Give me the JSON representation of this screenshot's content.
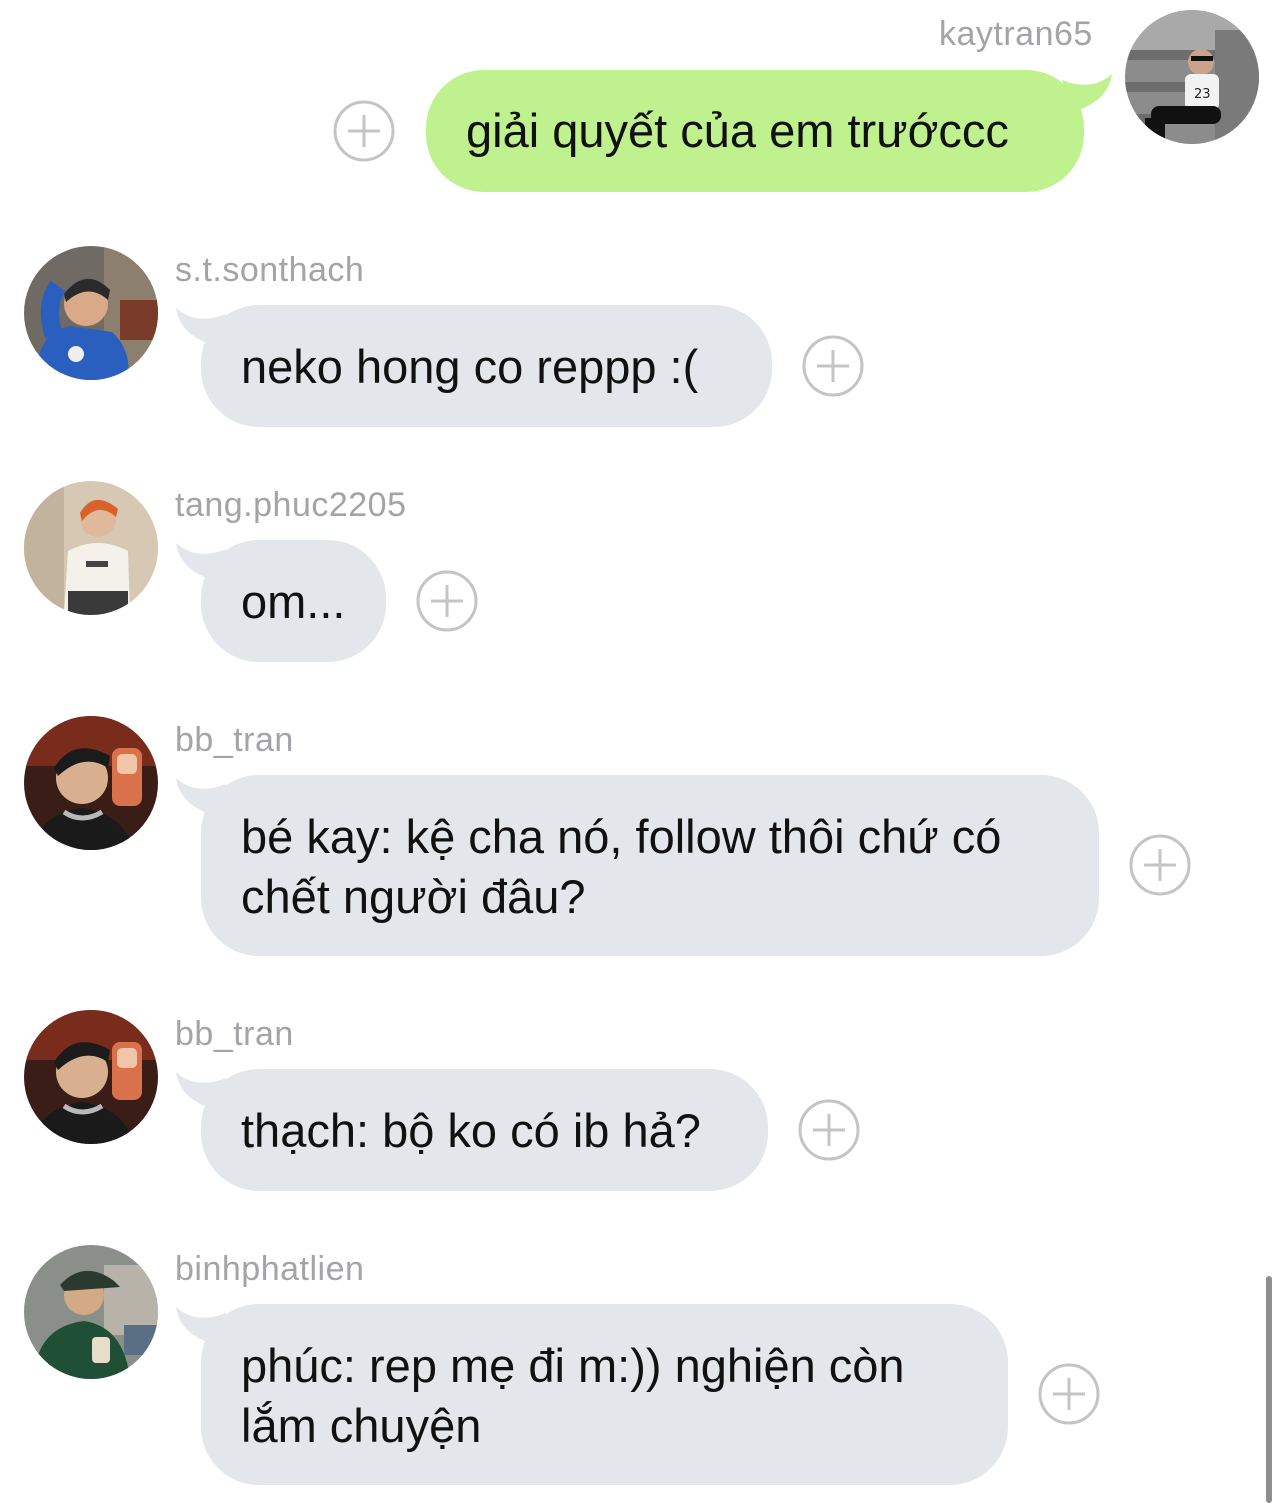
{
  "colors": {
    "my_bubble": "#bff28e",
    "their_bubble": "#e3e7eb",
    "username_text": "#a4a4a8",
    "message_text": "#111111",
    "react_icon": "#c4c4c8"
  },
  "react_icon": "add-reaction-plus-icon",
  "messages": [
    {
      "user": "kaytran65",
      "text": "giải quyết của em trướccc",
      "side": "right"
    },
    {
      "user": "s.t.sonthach",
      "text": "neko hong co reppp :(",
      "side": "left"
    },
    {
      "user": "tang.phuc2205",
      "text": "om...",
      "side": "left"
    },
    {
      "user": "bb_tran",
      "text": "bé kay: kệ cha nó, follow thôi chứ có chết người đâu?",
      "side": "left"
    },
    {
      "user": "bb_tran",
      "text": "thạch: bộ ko có ib hả?",
      "side": "left"
    },
    {
      "user": "binhphatlien",
      "text": "phúc: rep mẹ đi m:)) nghiện còn lắm chuyện",
      "side": "left"
    }
  ]
}
